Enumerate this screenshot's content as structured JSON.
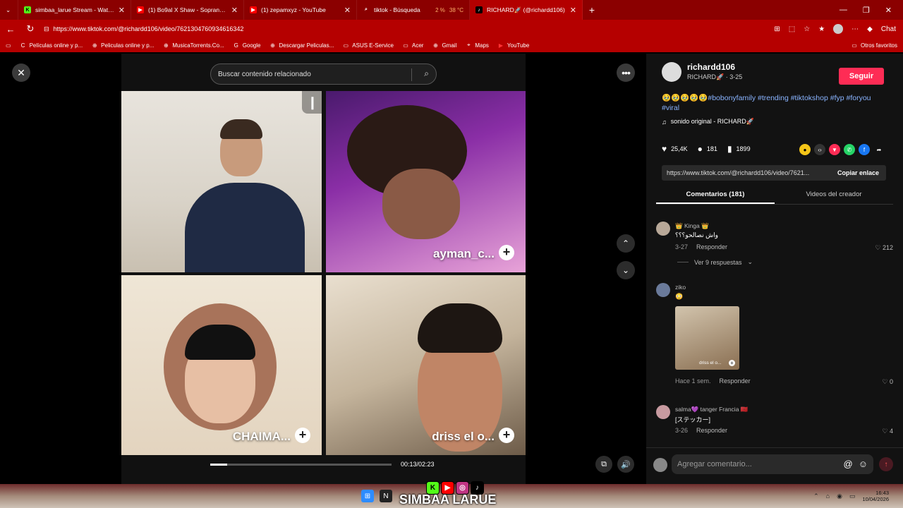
{
  "browser": {
    "tabs": [
      {
        "title": "simbaa_larue Stream - Watch Live",
        "fav": "K",
        "favcolor": "#53fc18"
      },
      {
        "title": "(1) Bo9al X Shaw - Soprano (Offic",
        "fav": "▶",
        "favcolor": "#ff0000"
      },
      {
        "title": "(1) zepamxyz - YouTube",
        "fav": "▶",
        "favcolor": "#ff0000"
      },
      {
        "title": "tiktok - Búsqueda",
        "fav": "⌕",
        "favcolor": "#8b0000"
      },
      {
        "title": "RICHARD🚀 (@richardd106)",
        "fav": "♪",
        "favcolor": "#000000"
      }
    ],
    "weather": {
      "cpu": "2 %",
      "temp": "38 °C"
    },
    "url": "https://www.tiktok.com/@richardd106/video/7621304760934616342",
    "bookmarks": [
      "Películas online y p...",
      "Peliculas online y p...",
      "MusicaTorrents.Co...",
      "Google",
      "Descargar Peliculas...",
      "ASUS E-Service",
      "Acer",
      "Gmail",
      "Maps",
      "YouTube"
    ],
    "bookmarks_right": "Otros favoritos",
    "chat_label": "Chat"
  },
  "viewer": {
    "search_placeholder": "Buscar contenido relacionado",
    "cells": [
      {
        "label": ""
      },
      {
        "label": "ayman_c..."
      },
      {
        "label": "CHAIMA..."
      },
      {
        "label": "driss el o..."
      }
    ],
    "progress": 0.095,
    "time": "00:13/02:23"
  },
  "side": {
    "author": {
      "username": "richardd106",
      "display": "RICHARD🚀 · 3-25"
    },
    "follow_label": "Seguir",
    "description_emojis": "🥹🥹🥹🥹🥹",
    "hashtags": "#bobonyfamily #trending #tiktokshop #fyp #foryou #viral",
    "sound": "sonido original - RICHARD🚀",
    "stats": {
      "likes": "25,4K",
      "comments": "181",
      "saves": "1899"
    },
    "link": "https://www.tiktok.com/@richardd106/video/7621...",
    "copy_label": "Copiar enlace",
    "tabs": [
      "Comentarios (181)",
      "Videos del creador"
    ],
    "comments": [
      {
        "name": "👑 Kinga 👑",
        "text": "واش نصالحو؟؟؟",
        "date": "3-27",
        "reply": "Responder",
        "likes": "212"
      },
      {
        "name": "ziko",
        "text": "😳",
        "date": "Hace 1 sem.",
        "reply": "Responder",
        "likes": "0"
      },
      {
        "name": "salma💜 tanger Francia 🇲🇦",
        "text": "[ステッカー]",
        "date": "3-26",
        "reply": "Responder",
        "likes": "4"
      }
    ],
    "view_replies": "Ver 9 respuestas",
    "thumb_label": "driss el o...",
    "comment_placeholder": "Agregar comentario..."
  },
  "taskbar": {
    "watermark": "SIMBAA LARUE",
    "time": "16:43",
    "date": "10/04/2026"
  }
}
